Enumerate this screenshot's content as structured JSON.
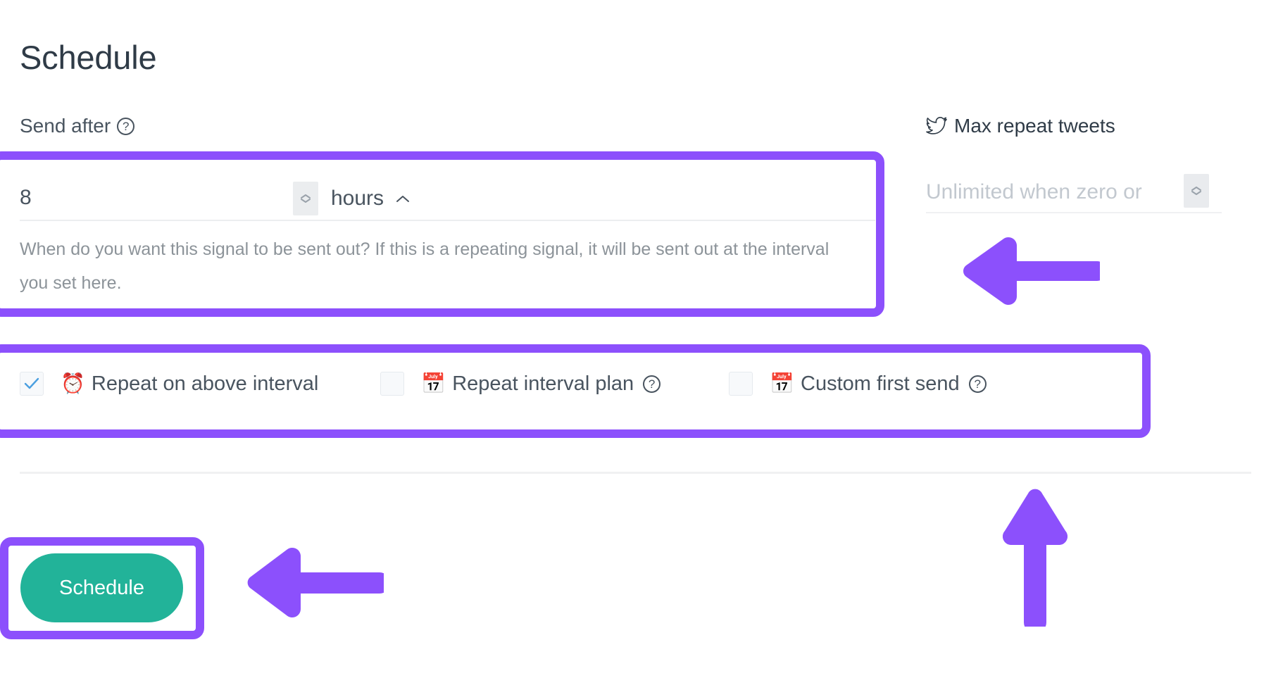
{
  "page": {
    "title": "Schedule"
  },
  "send_after": {
    "label": "Send after",
    "help_icon_char": "?",
    "value": "8",
    "unit": "hours",
    "help_text": "When do you want this signal to be sent out? If this is a repeating signal, it will be sent out at the interval you set here.",
    "spinner_icon": "number-stepper-icon",
    "unit_caret_icon": "chevron-up-icon"
  },
  "max_repeat": {
    "label": "Max repeat tweets",
    "icon": "twitter-bird-icon",
    "placeholder": "Unlimited when zero or",
    "value": "",
    "spinner_icon": "number-stepper-icon"
  },
  "checkboxes": [
    {
      "label": "Repeat on above interval",
      "icon": "alarm-clock-icon",
      "icon_char": "⏰",
      "checked": true,
      "has_help": false,
      "help_icon_char": "?"
    },
    {
      "label": "Repeat interval plan",
      "icon": "calendar-check-icon",
      "icon_char": "📅",
      "checked": false,
      "has_help": true,
      "help_icon_char": "?"
    },
    {
      "label": "Custom first send",
      "icon": "calendar-check-icon",
      "icon_char": "📅",
      "checked": false,
      "has_help": true,
      "help_icon_char": "?"
    }
  ],
  "actions": {
    "schedule_label": "Schedule"
  },
  "annotations": {
    "highlight_color": "#8c50fc",
    "boxes": [
      "send-after-field",
      "checkbox-row",
      "schedule-button"
    ],
    "arrows": [
      {
        "name": "arrow-to-max-repeat",
        "direction": "left"
      },
      {
        "name": "arrow-to-schedule-button",
        "direction": "left"
      },
      {
        "name": "arrow-to-checkbox-row",
        "direction": "up"
      }
    ]
  },
  "colors": {
    "accent_purple": "#8c50fc",
    "button_green": "#22b399",
    "text_primary": "#2f3b47",
    "text_secondary": "#49545f",
    "text_muted": "#8c9399",
    "placeholder": "#c2c8cf",
    "checkbox_check": "#4a9fe0"
  }
}
